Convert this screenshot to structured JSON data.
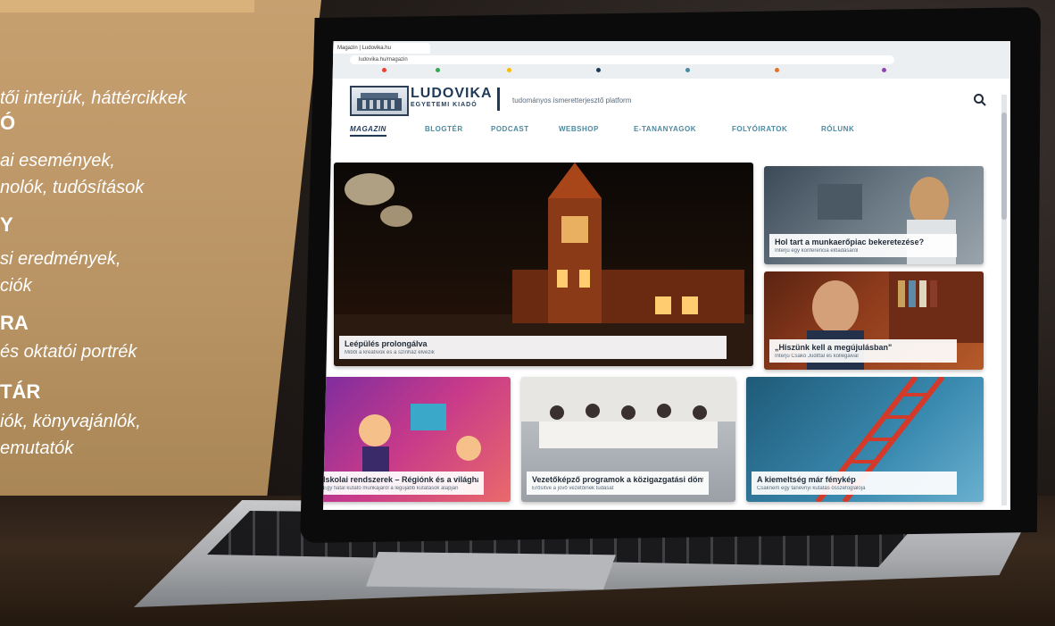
{
  "left_panel": {
    "items": [
      {
        "heading": "",
        "lines": [
          "tői interjúk, háttércikkek"
        ]
      },
      {
        "heading": "Ó",
        "lines": [
          "ai események,",
          "nolók, tudósítások"
        ]
      },
      {
        "heading": "Y",
        "lines": [
          "si eredmények,",
          "ciók"
        ]
      },
      {
        "heading": "RA",
        "lines": [
          "és oktatói portrék"
        ]
      },
      {
        "heading": "TÁR",
        "lines": [
          "iók, könyvajánlók,",
          "emutatók"
        ]
      }
    ]
  },
  "browser": {
    "tab_title": "Magazin | Ludovika.hu",
    "address": "ludovika.hu/magazin"
  },
  "site": {
    "logo_name": "LUDOVIKA",
    "logo_sub": "EGYETEMI KIADÓ",
    "tagline": "tudományos ismeretterjesztő platform",
    "nav": [
      "MAGAZIN",
      "BLOGTÉR",
      "PODCAST",
      "WEBSHOP",
      "E-TANANYAGOK",
      "FOLYÓIRATOK",
      "RÓLUNK"
    ],
    "cards": [
      {
        "title": "Leépülés prolongálva",
        "subtitle": "Miből a kreatívok és a színház élvezik"
      },
      {
        "title": "Hol tart a munkaerőpiac bekeretezése?",
        "subtitle": "Interjú egy konferencia előadásáról"
      },
      {
        "title": "„Hiszünk kell a megújulásban\"",
        "subtitle": "Interjú Csákó Judittal és kollégáival"
      },
      {
        "title": "Iskolai rendszerek – Régiónk és a világhálón",
        "subtitle": "Egy fiatal kutató munkájáról a legújabb kutatások alapján"
      },
      {
        "title": "Vezetőképző programok a közigazgatási döntéshozók számára",
        "subtitle": "Erősítve a jövő vezetőinek tudását"
      },
      {
        "title": "A kiemeltség már fénykép",
        "subtitle": "Csaknem egy tanévnyi kutatás összefoglalója"
      }
    ]
  },
  "colors": {
    "gold": "#b89363",
    "brand_navy": "#1f3a59",
    "nav_teal": "#4a8aa0"
  },
  "icons": {
    "search": "search-icon"
  }
}
